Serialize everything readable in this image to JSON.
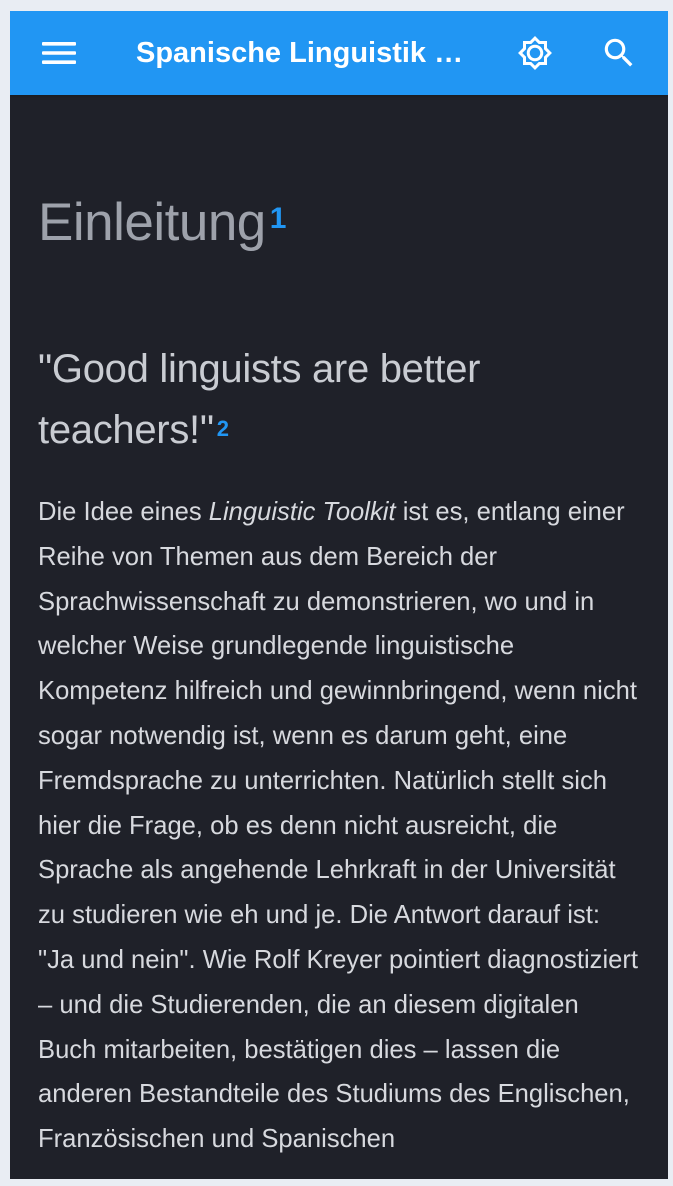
{
  "header": {
    "title": "Spanische Linguistik …",
    "menu_icon": "hamburger-menu-icon",
    "theme_icon": "brightness-icon",
    "search_icon": "search-icon",
    "background_color": "#2196f3"
  },
  "article": {
    "heading": "Einleitung",
    "heading_footnote": "1",
    "subheading": "\"Good linguists are better teachers!\"",
    "subheading_footnote": "2",
    "paragraph_intro": "Die Idee eines ",
    "paragraph_emphasis": "Linguistic Toolkit",
    "paragraph_rest": " ist es, entlang einer Reihe von Themen aus dem Bereich der Sprachwissenschaft zu demonstrieren, wo und in welcher Weise grundlegende linguistische Kompetenz hilfreich und gewinnbringend, wenn nicht sogar notwendig ist, wenn es darum geht, eine Fremdsprache zu unterrichten. Natürlich stellt sich hier die Frage, ob es denn nicht ausreicht, die Sprache als angehende Lehrkraft in der Universität zu studieren wie eh und je. Die Antwort darauf ist: \"Ja und nein\". Wie Rolf Kreyer pointiert diagnostiziert – und die Studierenden, die an diesem digitalen Buch mitarbeiten, bestätigen dies – lassen die anderen Bestandteile des Studiums des Englischen, Französischen und Spanischen"
  },
  "colors": {
    "page_background": "#1f2129",
    "heading_color": "#9ea2ab",
    "text_color": "#d7d9de",
    "accent": "#2196f3"
  }
}
